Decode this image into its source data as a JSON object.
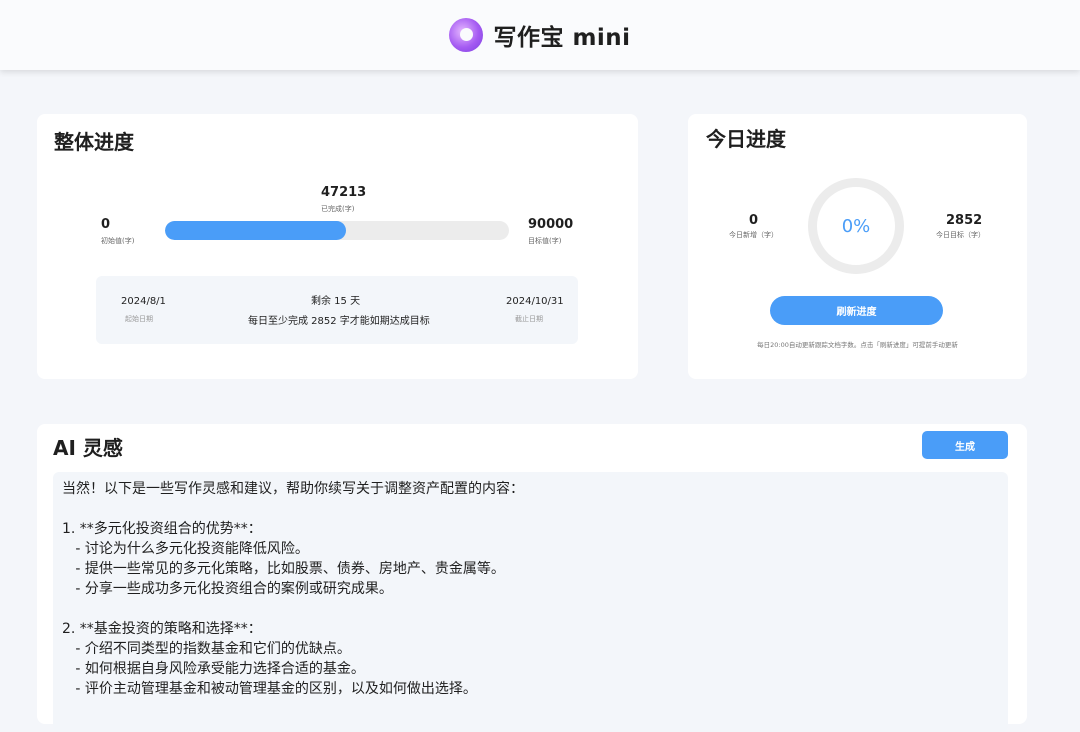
{
  "header": {
    "brand_name": "写作宝 mini"
  },
  "overall": {
    "title": "整体进度",
    "start_value": "0",
    "start_label": "初始值(字)",
    "completed_value": "47213",
    "completed_label": "已完成(字)",
    "target_value": "90000",
    "target_label": "目标值(字)",
    "progress_fraction": 0.525,
    "start_date": "2024/8/1",
    "start_date_label": "起始日期",
    "remaining_text": "剩余 15 天",
    "daily_text": "每日至少完成 2852 字才能如期达成目标",
    "end_date": "2024/10/31",
    "end_date_label": "截止日期"
  },
  "today": {
    "title": "今日进度",
    "new_value": "0",
    "new_label": "今日新增（字）",
    "percent": "0%",
    "goal_value": "2852",
    "goal_label": "今日目标（字）",
    "refresh_label": "刷新进度",
    "hint": "每日20:00自动更新跟踪文档字数。点击「刷新进度」可提前手动更新"
  },
  "ai": {
    "title": "AI 灵感",
    "generate_label": "生成",
    "lines": [
      "当然！以下是一些写作灵感和建议，帮助你续写关于调整资产配置的内容：",
      "",
      "1. **多元化投资组合的优势**：",
      "   - 讨论为什么多元化投资能降低风险。",
      "   - 提供一些常见的多元化策略，比如股票、债券、房地产、贵金属等。",
      "   - 分享一些成功多元化投资组合的案例或研究成果。",
      "",
      "2. **基金投资的策略和选择**：",
      "   - 介绍不同类型的指数基金和它们的优缺点。",
      "   - 如何根据自身风险承受能力选择合适的基金。",
      "   - 评价主动管理基金和被动管理基金的区别，以及如何做出选择。"
    ]
  }
}
